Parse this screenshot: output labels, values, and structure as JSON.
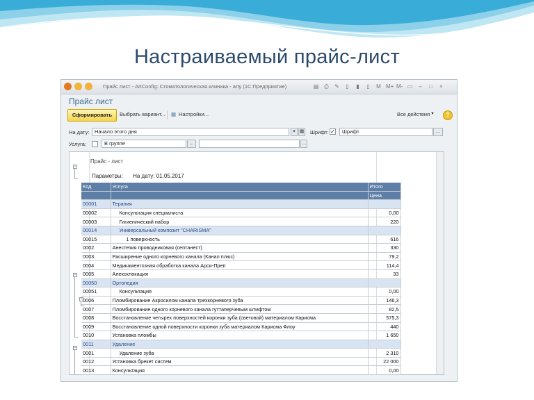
{
  "slide": {
    "title": "Настраиваемый прайс-лист"
  },
  "window": {
    "title": "Прайс лист - ArtConfig: Стоматологическая клиника - arty  (1С:Предприятие)",
    "form_title": "Прайс лист",
    "titlebar_tools": [
      "▤",
      "⎙",
      "✎",
      "▯",
      "▮",
      "▯",
      "M",
      "M+",
      "M-",
      "▭",
      "–",
      "□",
      "×"
    ]
  },
  "toolbar": {
    "generate_label": "Сформировать",
    "choose_variant_label": "Выбрать вариант...",
    "settings_label": "Настройки...",
    "all_actions_label": "Все действия",
    "help_label": "?"
  },
  "filters": {
    "date_label": "На дату:",
    "date_value": "Начало этого дня",
    "font_label": "Шрифт:",
    "font_checked": true,
    "font_value": "Шрифт",
    "service_label": "Услуга:",
    "service_checked": false,
    "service_mode": "В группе",
    "service_value": ""
  },
  "report": {
    "title": "Прайс - лист",
    "params_label": "Параметры:",
    "params_value": "На дату: 01.05.2017",
    "columns": {
      "code": "Код",
      "service": "Услуга",
      "total": "Итого",
      "price": "Цена"
    },
    "rows": [
      {
        "code": "00001",
        "name": "Терапия",
        "price": "",
        "group": true,
        "indent": 0
      },
      {
        "code": "00002",
        "name": "Консультация специалиста",
        "price": "0,00",
        "group": false,
        "indent": 1
      },
      {
        "code": "00003",
        "name": "Гигиенический набор",
        "price": "220",
        "group": false,
        "indent": 1
      },
      {
        "code": "00014",
        "name": "Универсальный композит \"CHARISMA\"",
        "price": "",
        "group": true,
        "indent": 1
      },
      {
        "code": "00015",
        "name": "1 поверхность",
        "price": "616",
        "group": false,
        "indent": 2
      },
      {
        "code": "0002",
        "name": "Анестезия проводниковая (септанест)",
        "price": "330",
        "group": false,
        "indent": 0
      },
      {
        "code": "0003",
        "name": "Расширение одного корневого канала (Канал плюс)",
        "price": "79,2",
        "group": false,
        "indent": 0
      },
      {
        "code": "0004",
        "name": "Медикаментозная обработка канала Арси-Преп",
        "price": "114,4",
        "group": false,
        "indent": 0
      },
      {
        "code": "0005",
        "name": "Алексклокация",
        "price": "33",
        "group": false,
        "indent": 0
      },
      {
        "code": "00050",
        "name": "Ортопедия",
        "price": "",
        "group": true,
        "indent": 0
      },
      {
        "code": "00051",
        "name": "Консультация",
        "price": "0,00",
        "group": false,
        "indent": 1
      },
      {
        "code": "0006",
        "name": "Пломбирование Акросилом канала трехкорневого зуба",
        "price": "146,3",
        "group": false,
        "indent": 0
      },
      {
        "code": "0007",
        "name": "Пломбирование одного корневого канала гуттаперчевым штифтом",
        "price": "82,5",
        "group": false,
        "indent": 0
      },
      {
        "code": "0008",
        "name": "Восстановление четырех поверхностей коронки зуба (световой) материалом Карисма",
        "price": "575,3",
        "group": false,
        "indent": 0
      },
      {
        "code": "0009",
        "name": "Восстановление одной поверхности коронки зуба материалом Карисма Флоу",
        "price": "440",
        "group": false,
        "indent": 0
      },
      {
        "code": "0010",
        "name": "Установка пломбы",
        "price": "1 650",
        "group": false,
        "indent": 0
      },
      {
        "code": "0011",
        "name": "Удаление",
        "price": "",
        "group": true,
        "indent": 0
      },
      {
        "code": "0001",
        "name": "Удаление зуба",
        "price": "2 310",
        "group": false,
        "indent": 1
      },
      {
        "code": "0012",
        "name": "Установка брекет систем",
        "price": "22 000",
        "group": false,
        "indent": 0
      },
      {
        "code": "0013",
        "name": "Консультация",
        "price": "0,00",
        "group": false,
        "indent": 0
      }
    ]
  },
  "colors": {
    "header": "#5d7ea6",
    "group_row": "#d9e4f2",
    "generate_button": "#f4d54a",
    "slide_title": "#2b4a6b"
  }
}
